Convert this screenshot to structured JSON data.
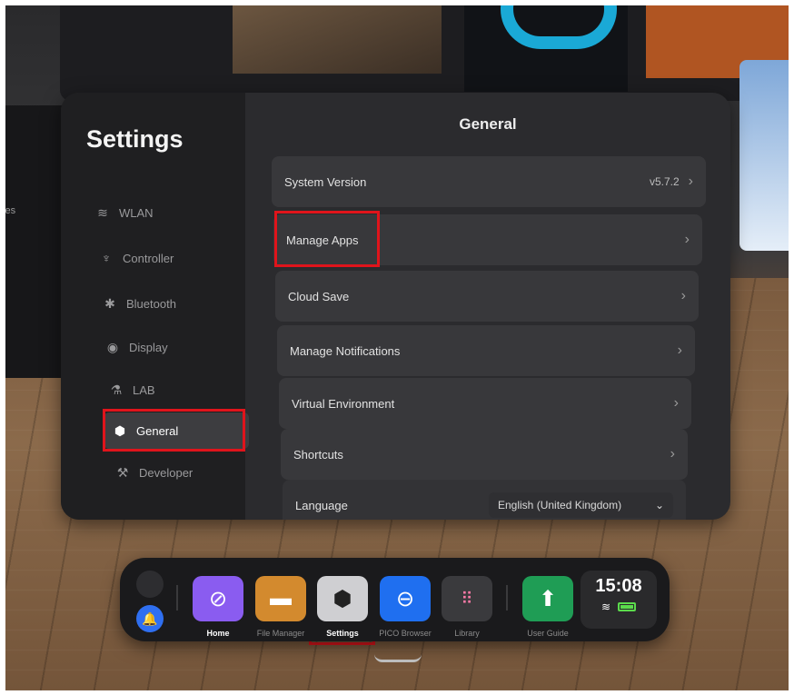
{
  "background": {
    "left_panel_text": "ces"
  },
  "settings": {
    "title": "Settings",
    "content_title": "General",
    "sidebar": [
      {
        "label": "WLAN",
        "icon": "wifi-icon"
      },
      {
        "label": "Controller",
        "icon": "controller-icon"
      },
      {
        "label": "Bluetooth",
        "icon": "bluetooth-icon"
      },
      {
        "label": "Display",
        "icon": "eye-icon"
      },
      {
        "label": "LAB",
        "icon": "flask-icon"
      },
      {
        "label": "General",
        "icon": "hexagon-gear-icon",
        "active": true
      },
      {
        "label": "Developer",
        "icon": "tools-icon"
      }
    ],
    "rows": {
      "system_version": {
        "label": "System Version",
        "value": "v5.7.2"
      },
      "manage_apps": {
        "label": "Manage Apps"
      },
      "cloud_save": {
        "label": "Cloud Save"
      },
      "manage_notifications": {
        "label": "Manage Notifications"
      },
      "virtual_environment": {
        "label": "Virtual Environment"
      },
      "shortcuts": {
        "label": "Shortcuts"
      },
      "language": {
        "label": "Language",
        "selected": "English (United Kingdom)"
      }
    }
  },
  "dock": {
    "apps": [
      {
        "label": "Home",
        "icon": "home-compass-icon",
        "color": "#8a5cf0"
      },
      {
        "label": "File Manager",
        "icon": "folder-icon",
        "color": "#d38a2e"
      },
      {
        "label": "Settings",
        "icon": "settings-icon",
        "color": "#cfcfd2",
        "active": true
      },
      {
        "label": "PICO Browser",
        "icon": "browser-icon",
        "color": "#1f6ff0"
      },
      {
        "label": "Library",
        "icon": "grid-icon",
        "color": "#3a3a3d"
      },
      {
        "label": "User Guide",
        "icon": "arrow-up-icon",
        "color": "#1f9d55"
      }
    ],
    "clock": "15:08"
  },
  "colors": {
    "highlight": "#e0141b",
    "window_bg": "#2b2b2e",
    "sidebar_bg": "#1f1f21"
  }
}
